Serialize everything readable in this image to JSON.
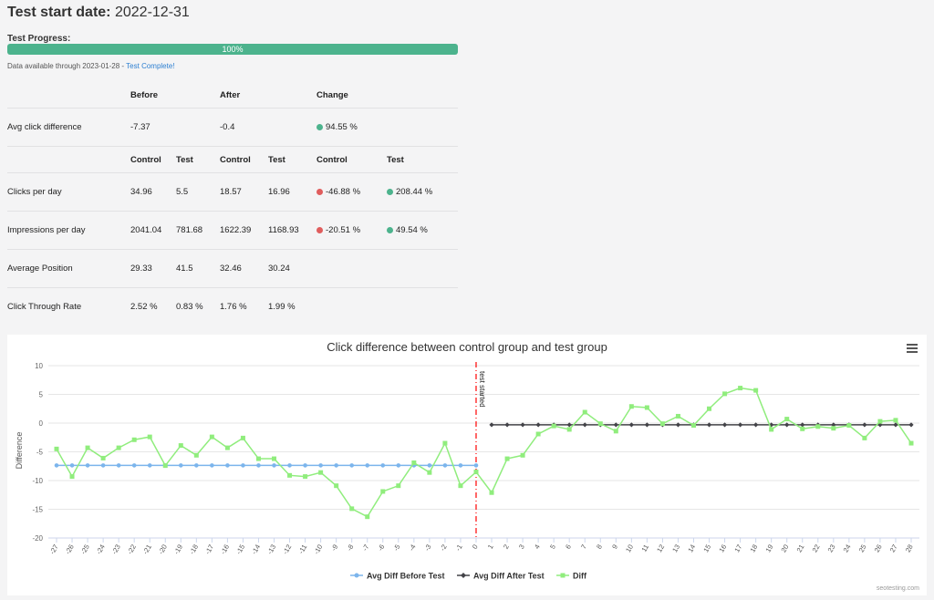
{
  "header": {
    "label": "Test start date:",
    "date": "2022-12-31"
  },
  "progress": {
    "label": "Test Progress:",
    "value_text": "100%",
    "value": 1.0
  },
  "availability": {
    "text": "Data available through 2023-01-28 - ",
    "link": "Test Complete!"
  },
  "table": {
    "header1": [
      "Before",
      "After",
      "Change"
    ],
    "avg_row": {
      "label": "Avg click difference",
      "before": "-7.37",
      "after": "-0.4",
      "change": "94.55 %"
    },
    "header2": [
      "Control",
      "Test",
      "Control",
      "Test",
      "Control",
      "Test"
    ],
    "rows": [
      {
        "label": "Clicks per day",
        "v": [
          "34.96",
          "5.5",
          "18.57",
          "16.96"
        ],
        "c1": "-46.88 %",
        "c2": "208.44 %"
      },
      {
        "label": "Impressions per day",
        "v": [
          "2041.04",
          "781.68",
          "1622.39",
          "1168.93"
        ],
        "c1": "-20.51 %",
        "c2": "49.54 %"
      },
      {
        "label": "Average Position",
        "v": [
          "29.33",
          "41.5",
          "32.46",
          "30.24"
        ],
        "c1": "",
        "c2": ""
      },
      {
        "label": "Click Through Rate",
        "v": [
          "2.52 %",
          "0.83 %",
          "1.76 %",
          "1.99 %"
        ],
        "c1": "",
        "c2": ""
      }
    ]
  },
  "colors": {
    "positive": "#4cb38d",
    "negative": "#e05d5d",
    "before": "#7cb5ec",
    "after": "#434348",
    "diff": "#90ed7d",
    "plotline": "#ff0000"
  },
  "chart_data": {
    "type": "line",
    "title": "Click difference between control group and test group",
    "ylabel": "Difference",
    "ylim": [
      -20,
      10
    ],
    "yticks": [
      10,
      5,
      0,
      -5,
      -10,
      -15,
      -20
    ],
    "plotline": {
      "x": 0,
      "label": "test started"
    },
    "x": [
      -27,
      -26,
      -25,
      -24,
      -23,
      -22,
      -21,
      -20,
      -19,
      -18,
      -17,
      -16,
      -15,
      -14,
      -13,
      -12,
      -11,
      -10,
      -9,
      -8,
      -7,
      -6,
      -5,
      -4,
      -3,
      -2,
      -1,
      0,
      1,
      2,
      3,
      4,
      5,
      6,
      7,
      8,
      9,
      10,
      11,
      12,
      13,
      14,
      15,
      16,
      17,
      18,
      19,
      20,
      21,
      22,
      23,
      24,
      25,
      26,
      27,
      28
    ],
    "series": [
      {
        "name": "Avg Diff Before Test",
        "marker": "circle",
        "x_start": -27,
        "x_end": 0,
        "value": -7.37
      },
      {
        "name": "Avg Diff After Test",
        "marker": "diamond",
        "x_start": 1,
        "x_end": 28,
        "value": -0.3
      },
      {
        "name": "Diff",
        "marker": "square",
        "x_start": -27,
        "values": [
          -4.5,
          -9.3,
          -4.3,
          -6.1,
          -4.3,
          -2.9,
          -2.4,
          -7.4,
          -3.9,
          -5.6,
          -2.4,
          -4.3,
          -2.6,
          -6.2,
          -6.2,
          -9.1,
          -9.3,
          -8.6,
          -10.9,
          -14.9,
          -16.3,
          -11.9,
          -10.9,
          -6.9,
          -8.6,
          -3.5,
          -10.9,
          -8.5,
          -12.1,
          -6.2,
          -5.6,
          -1.9,
          -0.5,
          -1.1,
          1.9,
          -0.1,
          -1.4,
          2.9,
          2.7,
          -0.1,
          1.2,
          -0.4,
          2.5,
          5.1,
          6.1,
          5.7,
          -1.1,
          0.7,
          -1.0,
          -0.6,
          -0.9,
          -0.4,
          -2.6,
          0.3,
          0.5,
          -3.5
        ]
      }
    ],
    "credit": "seotesting.com"
  }
}
